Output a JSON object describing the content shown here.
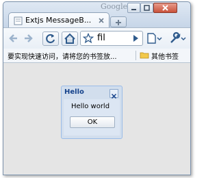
{
  "window": {
    "corner_text": "Google"
  },
  "tab": {
    "title": "Extjs MessageB..."
  },
  "toolbar": {
    "omnibox_text": "fil"
  },
  "bookmarks": {
    "prompt": "要实现快速访问，请将您的书签放...",
    "other_bookmarks": "其他书签"
  },
  "dialog": {
    "title": "Hello",
    "message": "Hello world",
    "ok_label": "OK"
  },
  "colors": {
    "dialog_title": "#15428b",
    "dialog_border": "#99bbe8",
    "content_background": "#e5e5e5"
  },
  "icons": [
    "minimize-icon",
    "maximize-icon",
    "close-icon",
    "favicon-icon",
    "tab-close-icon",
    "new-tab-icon",
    "back-icon",
    "forward-icon",
    "reload-icon",
    "home-icon",
    "star-icon",
    "go-icon",
    "page-menu-icon",
    "wrench-icon",
    "folder-icon",
    "dialog-close-icon"
  ]
}
